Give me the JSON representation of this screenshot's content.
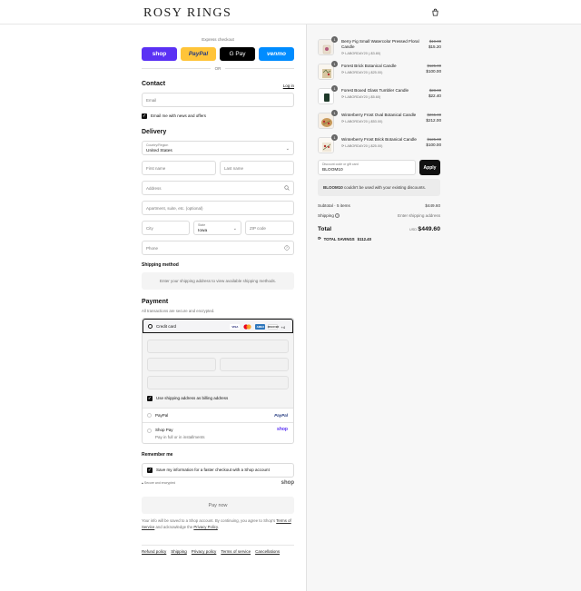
{
  "header": {
    "brand": "ROSY RINGS",
    "cart_icon": "shopping-bag-icon"
  },
  "express": {
    "label": "Express checkout",
    "buttons": [
      "shop",
      "PayPal",
      "G Pay",
      "venmo"
    ],
    "or": "OR"
  },
  "contact": {
    "title": "Contact",
    "login": "Log in",
    "email_placeholder": "Email",
    "newsletter": "Email me with news and offers",
    "newsletter_checked": true
  },
  "delivery": {
    "title": "Delivery",
    "country_label": "Country/Region",
    "country_value": "United States",
    "first_name": "First name",
    "last_name": "Last name",
    "address": "Address",
    "apartment": "Apartment, suite, etc. (optional)",
    "city": "City",
    "state_label": "State",
    "state_value": "Iowa",
    "zip": "ZIP code",
    "phone": "Phone"
  },
  "shipping": {
    "title": "Shipping method",
    "notice": "Enter your shipping address to view available shipping methods."
  },
  "payment": {
    "title": "Payment",
    "subtitle": "All transactions are secure and encrypted.",
    "credit_card": "Credit card",
    "card_brands": [
      "VISA",
      "MC",
      "AMEX",
      "DISCOVER"
    ],
    "more_cards": "+4",
    "billing_same": "Use shipping address as billing address",
    "paypal": "PayPal",
    "paypal_logo": "PayPal",
    "shop_pay": "Shop Pay",
    "shop_pay_sub": "Pay in full or in installments",
    "shop_logo": "shop"
  },
  "remember": {
    "title": "Remember me",
    "save_info": "Save my information for a faster checkout with a Shop account",
    "secure": "Secure and encrypted",
    "shop_logo": "shop"
  },
  "pay_now": "Pay now",
  "legal": {
    "text1": "Your info will be saved to a Shop account. By continuing, you agree to Shop's",
    "terms": "Terms of Service",
    "text2": "and acknowledge the",
    "privacy": "Privacy Policy",
    "end": "."
  },
  "footer": [
    "Refund policy",
    "Shipping",
    "Privacy policy",
    "Terms of service",
    "Cancellations"
  ],
  "cart": {
    "items": [
      {
        "qty": "1",
        "name": "Berry Fig Small Watercolor Pressed Floral Candle",
        "code": "LABORDAY20 (-$3.80)",
        "old": "$19.00",
        "new": "$15.20"
      },
      {
        "qty": "1",
        "name": "Forest Brick Botanical Candle",
        "code": "LABORDAY20 (-$25.00)",
        "old": "$125.00",
        "new": "$100.00"
      },
      {
        "qty": "1",
        "name": "Forest Boxed Glass Tumbler Candle",
        "code": "LABORDAY20 (-$5.60)",
        "old": "$28.00",
        "new": "$22.40"
      },
      {
        "qty": "1",
        "name": "Winterberry Frost Oval Botanical Candle",
        "code": "LABORDAY20 (-$53.00)",
        "old": "$265.00",
        "new": "$212.00"
      },
      {
        "qty": "1",
        "name": "Winterberry Frost Brick Botanical Candle",
        "code": "LABORDAY20 (-$25.00)",
        "old": "$125.00",
        "new": "$100.00"
      }
    ],
    "discount_label": "Discount code or gift card",
    "discount_value": "BLOOM10",
    "apply": "Apply",
    "discount_msg_code": "BLOOM10",
    "discount_msg_rest": "couldn't be used with your existing discounts.",
    "subtotal_label": "Subtotal · 5 items",
    "subtotal_value": "$449.60",
    "shipping_label": "Shipping",
    "shipping_value": "Enter shipping address",
    "total_label": "Total",
    "currency": "USD",
    "total_value": "$449.60",
    "savings_label": "TOTAL SAVINGS",
    "savings_value": "$112.40"
  }
}
